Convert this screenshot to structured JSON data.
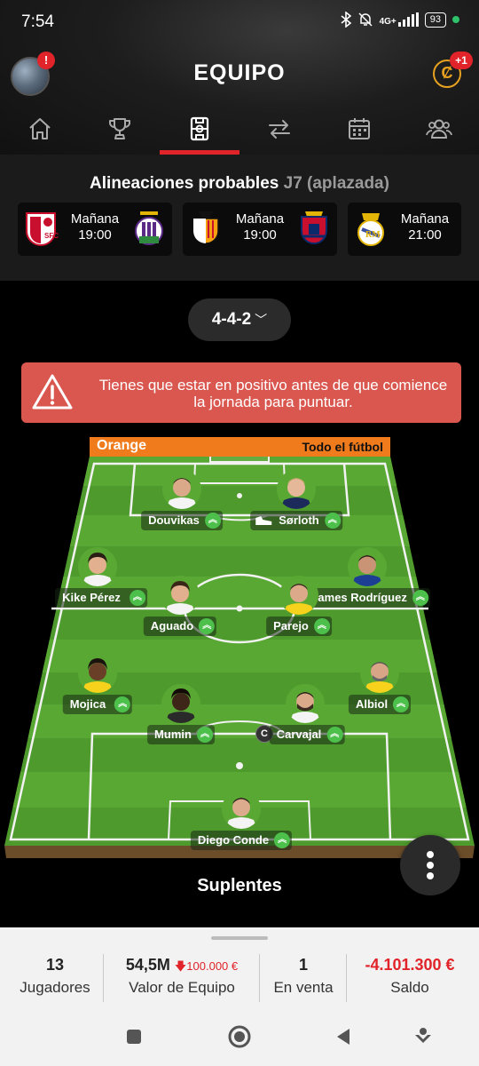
{
  "status_bar": {
    "time": "7:54",
    "network": "4G+",
    "battery": "93"
  },
  "header": {
    "title": "EQUIPO",
    "avatar_badge": "!",
    "coins_symbol": "Ȼ",
    "coins_badge": "+1"
  },
  "nav": {
    "items": [
      {
        "icon": "home-icon"
      },
      {
        "icon": "trophy-icon"
      },
      {
        "icon": "lineup-icon",
        "active": true
      },
      {
        "icon": "transfer-icon"
      },
      {
        "icon": "calendar-icon"
      },
      {
        "icon": "users-icon"
      }
    ]
  },
  "lineups": {
    "title": "Alineaciones probables",
    "jornada": "J7 (aplazada)",
    "matches": [
      {
        "day": "Mañana",
        "time": "19:00",
        "home": "Sevilla crest",
        "away": "Real Valladolid crest"
      },
      {
        "day": "Mañana",
        "time": "19:00",
        "home": "Valencia crest",
        "away": "Osasuna crest"
      },
      {
        "day": "Mañana",
        "time": "21:00",
        "home": "Real Madrid crest"
      }
    ]
  },
  "formation": {
    "label": "4-4-2"
  },
  "alert": {
    "text": "Tienes que estar en positivo antes de que comience la jornada para puntuar."
  },
  "pitch": {
    "ad_left": "Orange",
    "ad_right": "Todo el fútbol",
    "players": [
      {
        "name": "Douvikas"
      },
      {
        "name": "Sørloth",
        "has_boot": true
      },
      {
        "name": "Kike Pérez"
      },
      {
        "name": "James Rodríguez"
      },
      {
        "name": "Aguado"
      },
      {
        "name": "Parejo"
      },
      {
        "name": "Mojica"
      },
      {
        "name": "Albiol"
      },
      {
        "name": "Mumin"
      },
      {
        "name": "Carvajal",
        "captain": "C"
      },
      {
        "name": "Diego Conde"
      }
    ]
  },
  "suplentes": {
    "title": "Suplentes"
  },
  "summary": {
    "players_value": "13",
    "players_label": "Jugadores",
    "team_value": "54,5M",
    "team_change": "100.000 €",
    "team_label": "Valor de Equipo",
    "sale_value": "1",
    "sale_label": "En venta",
    "balance_value": "-4.101.300 €",
    "balance_label": "Saldo"
  },
  "colors": {
    "accent": "#e0242a",
    "pitch": "#4c9a2a",
    "alert": "#d9574f",
    "ad": "#f07b1c",
    "arrow": "#4cc04a"
  }
}
